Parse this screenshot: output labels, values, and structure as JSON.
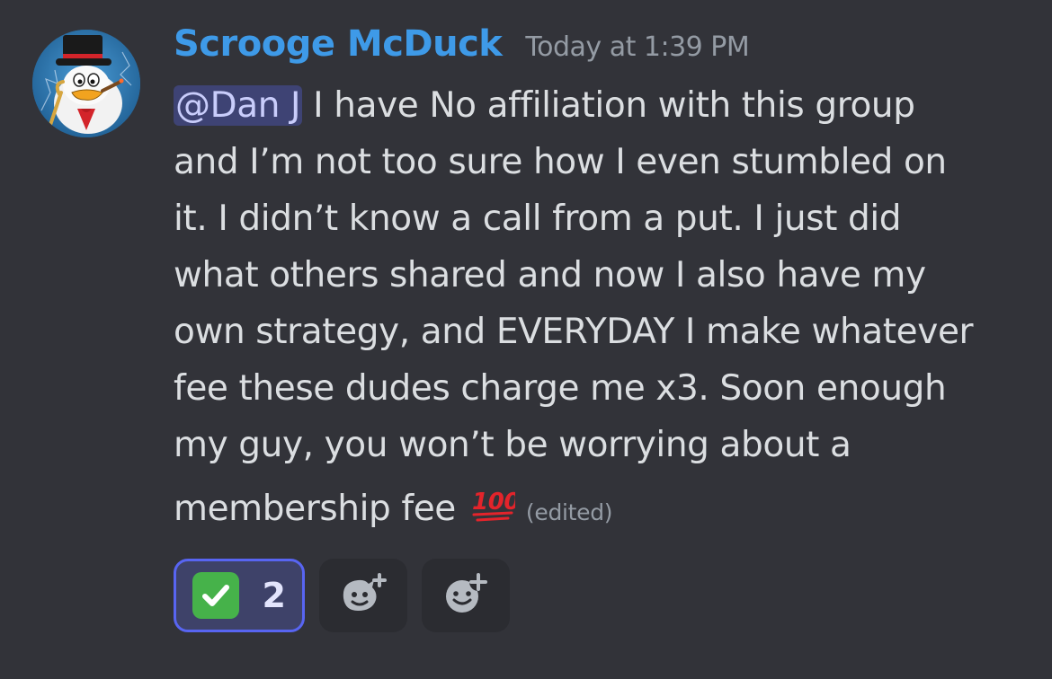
{
  "message": {
    "author": "Scrooge McDuck",
    "timestamp": "Today at 1:39 PM",
    "mention": "@Dan J",
    "text_lines": [
      " I have No affiliation with this group",
      "and I’m not too sure how I even stumbled on",
      "it. I didn’t know a call from a put. I just did",
      "what others shared and now I also have my",
      "own strategy, and EVERYDAY I make whatever",
      "fee these dudes charge me x3. Soon enough",
      "my guy, you won’t be worrying about a"
    ],
    "last_line_text": "membership fee ",
    "inline_emoji": "hundred-points-emoji",
    "edited_label": "(edited)"
  },
  "reactions": [
    {
      "emoji": "white-check-mark",
      "count": "2",
      "active": true
    },
    {
      "emoji": "add-super-reaction",
      "count": null,
      "active": false
    },
    {
      "emoji": "add-reaction",
      "count": null,
      "active": false
    }
  ],
  "colors": {
    "background": "#323339",
    "username": "#3e9ae8",
    "timestamp": "#949ba4",
    "text": "#dbdee1",
    "mention_bg": "#3e4374",
    "mention_text": "#c9cdfb",
    "reaction_active_bg": "#3e4269",
    "reaction_active_border": "#5865f2",
    "reaction_bg": "#2b2c31",
    "check_green": "#46b24a"
  }
}
